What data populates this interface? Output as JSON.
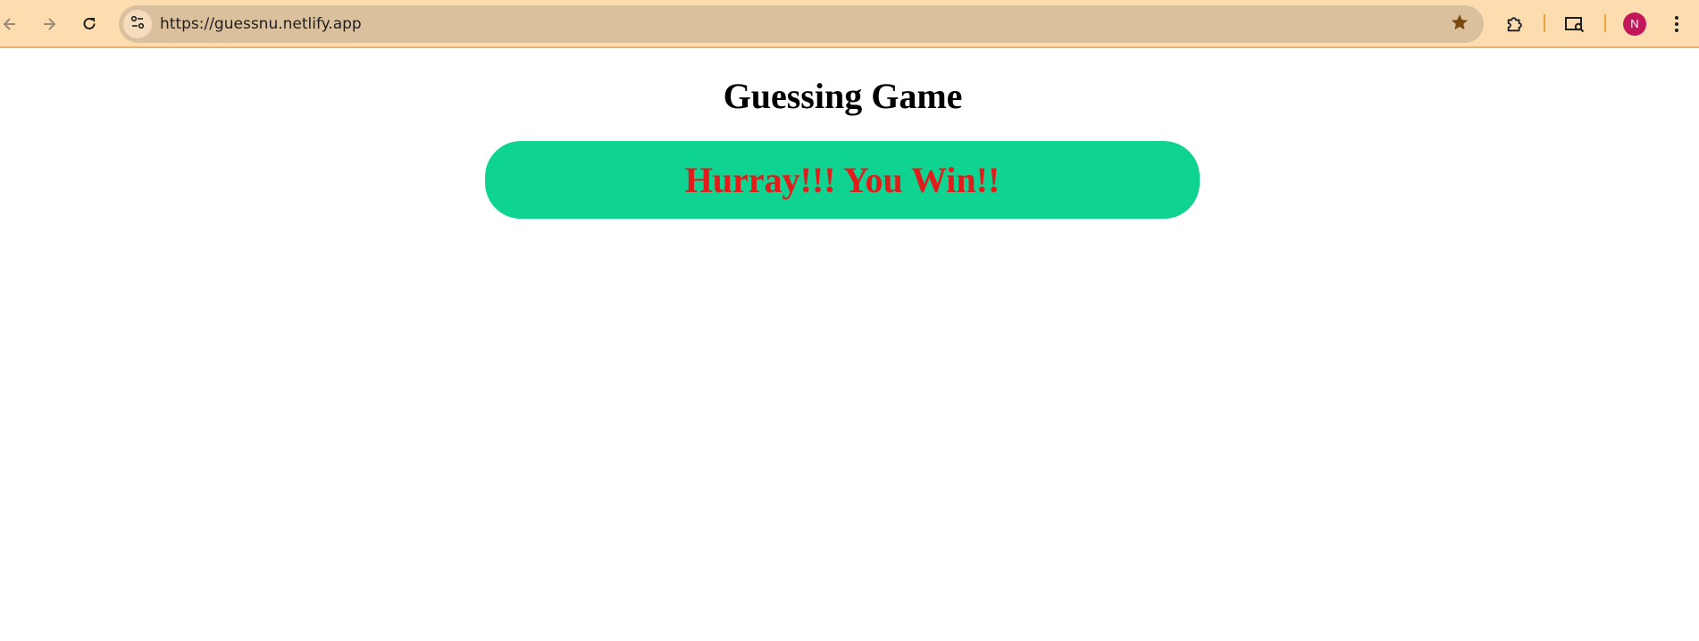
{
  "browser": {
    "url": "https://guessnu.netlify.app",
    "profile_initial": "N",
    "theme_color": "#fddcb0",
    "icons": {
      "back": "arrow-left-icon",
      "forward": "arrow-right-icon",
      "reload": "reload-icon",
      "site_info": "site-settings-icon",
      "bookmark": "star-icon",
      "extensions": "puzzle-icon",
      "cast": "search-tabs-icon",
      "menu": "kebab-menu-icon"
    }
  },
  "page": {
    "title": "Guessing Game",
    "result_message": "Hurray!!! You Win!!",
    "banner_color": "#0fd390",
    "message_color": "#e31b1b"
  }
}
